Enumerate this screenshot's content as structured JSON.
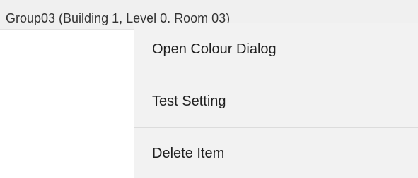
{
  "tree": {
    "selected_item_label": "Group03 (Building 1, Level 0, Room 03)"
  },
  "context_menu": {
    "items": [
      {
        "label": "Open Colour Dialog"
      },
      {
        "label": "Test Setting"
      },
      {
        "label": "Delete Item"
      }
    ]
  }
}
